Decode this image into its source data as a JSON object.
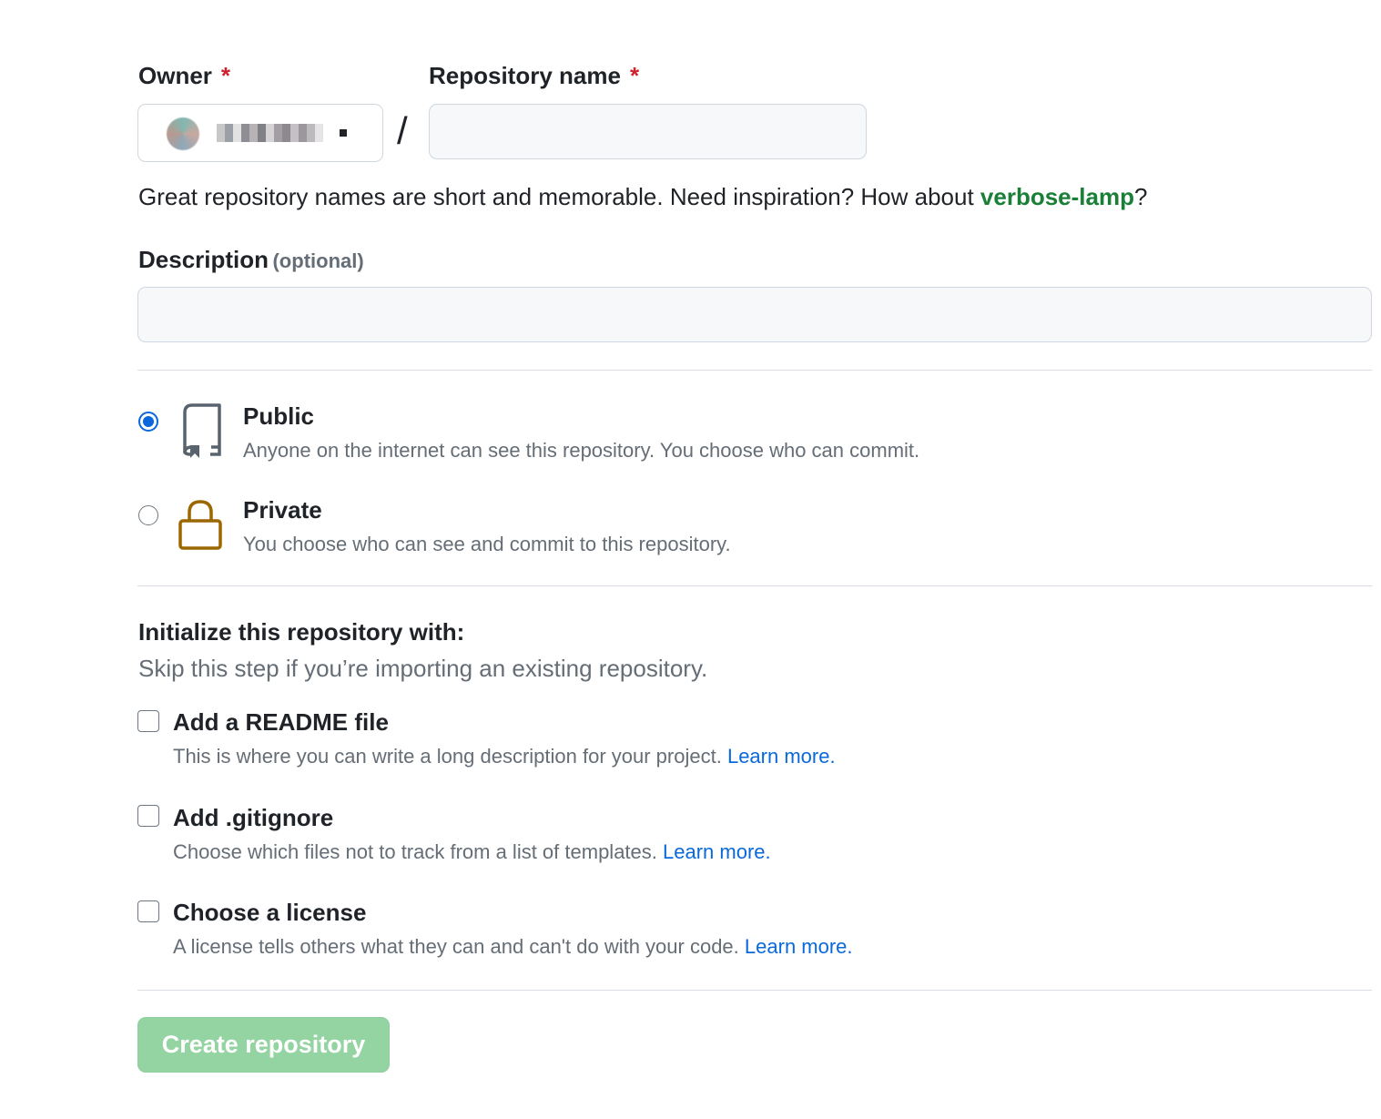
{
  "owner": {
    "label": "Owner",
    "required_mark": "*",
    "value": "",
    "avatar_icon": "user-avatar"
  },
  "repo_name": {
    "label": "Repository name",
    "required_mark": "*",
    "value": "",
    "placeholder": ""
  },
  "separator": "/",
  "name_hint": {
    "text": "Great repository names are short and memorable. Need inspiration? How about ",
    "suggestion": "verbose-lamp",
    "suffix": "?"
  },
  "description": {
    "label": "Description",
    "optional": "(optional)",
    "value": ""
  },
  "visibility": {
    "selected": "public",
    "options": [
      {
        "id": "public",
        "title": "Public",
        "description": "Anyone on the internet can see this repository. You choose who can commit.",
        "icon": "repo-icon"
      },
      {
        "id": "private",
        "title": "Private",
        "description": "You choose who can see and commit to this repository.",
        "icon": "lock-icon"
      }
    ]
  },
  "initialize": {
    "title": "Initialize this repository with:",
    "subtitle": "Skip this step if you’re importing an existing repository.",
    "options": [
      {
        "title": "Add a README file",
        "description": "This is where you can write a long description for your project. ",
        "link": "Learn more.",
        "checked": false
      },
      {
        "title": "Add .gitignore",
        "description": "Choose which files not to track from a list of templates. ",
        "link": "Learn more.",
        "checked": false
      },
      {
        "title": "Choose a license",
        "description": "A license tells others what they can and can't do with your code. ",
        "link": "Learn more.",
        "checked": false
      }
    ]
  },
  "submit": {
    "label": "Create repository",
    "enabled": false
  },
  "colors": {
    "required": "#cf222e",
    "suggestion": "#1a7f37",
    "link": "#0969da",
    "radio_selected": "#0969da",
    "lock_icon": "#9a6700",
    "button_disabled": "#94d3a2"
  }
}
